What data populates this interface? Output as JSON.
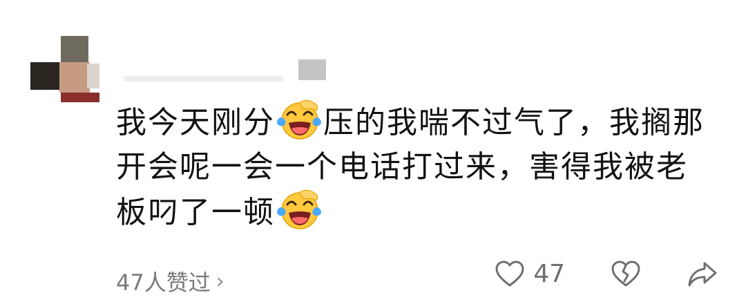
{
  "comment": {
    "segments": [
      {
        "type": "text",
        "value": "我今天刚分"
      },
      {
        "type": "emoji",
        "name": "laughing-crying-emoji"
      },
      {
        "type": "text",
        "value": "压的我喘不过气了，我搁那开会呢一会一个电话打过来，害得我被老板叼了一顿"
      },
      {
        "type": "emoji",
        "name": "laughing-crying-emoji"
      }
    ]
  },
  "footer": {
    "likes_text": "47人赞过",
    "likes_chevron": "›",
    "like_count": "47"
  },
  "icons": {
    "like": "heart-outline-icon",
    "dislike": "broken-heart-icon",
    "share": "share-arrow-icon"
  },
  "colors": {
    "text": "#121212",
    "muted": "#7a7a7a",
    "icon": "#6f6f6f",
    "emoji_face": "#ffc83d"
  }
}
